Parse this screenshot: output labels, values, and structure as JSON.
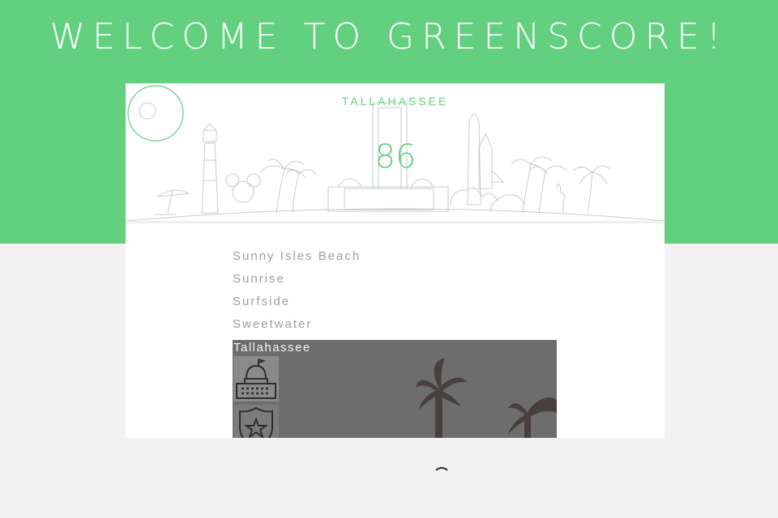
{
  "header": {
    "title": "WELCOME TO GREENSCORE!"
  },
  "city_card": {
    "city_name": "TALLAHASSEE",
    "score": "86",
    "cities": [
      "Sunny Isles Beach",
      "Sunrise",
      "Surfside",
      "Sweetwater"
    ],
    "selected_city": "Tallahassee",
    "icons": [
      "capitol-building-icon",
      "police-badge-icon"
    ]
  },
  "colors": {
    "brand_green": "#62d07f",
    "page_background": "#f2f2f2",
    "card_background": "#ffffff",
    "list_text": "#9aa0a0"
  }
}
